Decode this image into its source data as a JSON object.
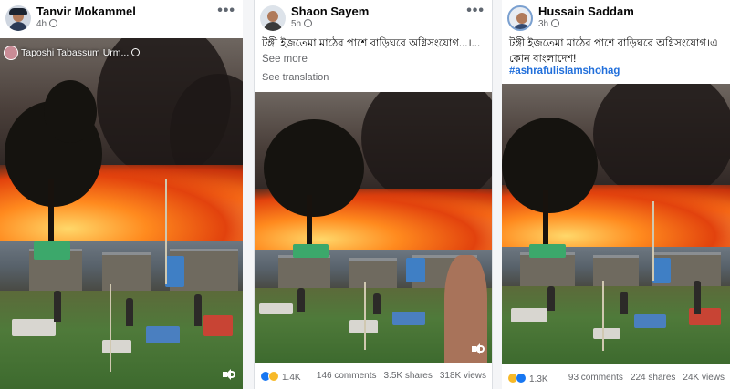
{
  "posts": [
    {
      "author": "Tanvir Mokammel",
      "time": "4h",
      "video_overlay": "Taposhi Tabassum Urm...",
      "icons": {
        "avatar": "avatar-man-cap",
        "privacy": "globe-icon",
        "more": "more-icon",
        "volume": "volume-icon"
      }
    },
    {
      "author": "Shaon Sayem",
      "time": "5h",
      "caption": "টঙ্গী ইজতেমা মাঠের পাশে বাড়িঘরে অগ্নিসংযোগ...।...",
      "see_more": "See more",
      "see_translation": "See translation",
      "reactions": "1.4K",
      "comments": "146 comments",
      "shares": "3.5K shares",
      "views": "318K views",
      "icons": {
        "avatar": "avatar-man",
        "privacy": "globe-icon",
        "more": "more-icon",
        "volume": "volume-icon",
        "reaction1": "like-icon",
        "reaction2": "sad-icon"
      }
    },
    {
      "author": "Hussain Saddam",
      "time": "3h",
      "caption": "টঙ্গী ইজতেমা মাঠের পাশে বাড়িঘরে অগ্নিসংযোগ।এ কোন বাংলাদেশ!",
      "hashtag": "#ashrafulislamshohag",
      "reactions": "1.3K",
      "comments": "93 comments",
      "shares": "224 shares",
      "views": "24K views",
      "icons": {
        "avatar": "avatar-man-circle",
        "privacy": "globe-icon",
        "more": "more-icon",
        "volume": "volume-icon",
        "reaction1": "sad-icon",
        "reaction2": "like-icon"
      }
    }
  ],
  "more_glyph": "•••",
  "colors": {
    "link": "#216fdb",
    "muted": "#65676b",
    "fire": "#ff8a1e",
    "like": "#1877f2",
    "sad": "#f7b928"
  }
}
